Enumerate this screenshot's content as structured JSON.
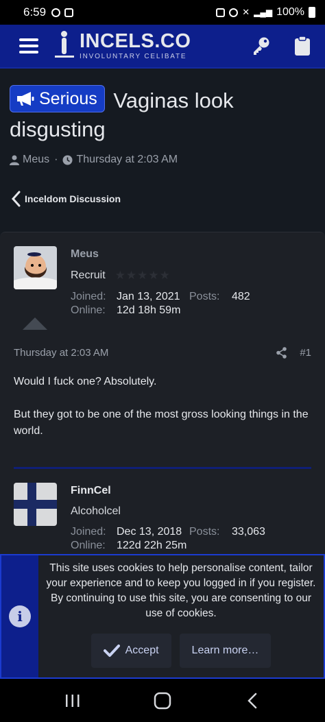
{
  "status": {
    "time": "6:59",
    "battery": "100%"
  },
  "site": {
    "title": "INCELS.CO",
    "subtitle": "INVOLUNTARY CELIBATE"
  },
  "thread": {
    "prefix": "Serious",
    "title": "Vaginas look disgusting",
    "author": "Meus",
    "date": "Thursday at 2:03 AM"
  },
  "breadcrumb": {
    "label": "Inceldom Discussion"
  },
  "posts": [
    {
      "username": "Meus",
      "usertitle": "Recruit",
      "joined_label": "Joined:",
      "joined": "Jan 13, 2021",
      "posts_label": "Posts:",
      "posts": "482",
      "online_label": "Online:",
      "online": "12d 18h 59m",
      "date": "Thursday at 2:03 AM",
      "number": "#1",
      "body": [
        "Would I fuck one? Absolutely.",
        "But they got to be one of the most gross looking things in the world."
      ]
    },
    {
      "username": "FinnCel",
      "usertitle": "Alcoholcel",
      "joined_label": "Joined:",
      "joined": "Dec 13, 2018",
      "posts_label": "Posts:",
      "posts": "33,063",
      "online_label": "Online:",
      "online": "122d 22h 25m"
    }
  ],
  "cookie": {
    "text": "This site uses cookies to help personalise content, tailor your experience and to keep you logged in if you register. By continuing to use this site, you are consenting to our use of cookies.",
    "accept": "Accept",
    "learn_more": "Learn more…"
  },
  "colors": {
    "header": "#0d1f8c",
    "prefix": "#153cc4",
    "background": "#151a21",
    "post_bg": "#1d2026"
  }
}
